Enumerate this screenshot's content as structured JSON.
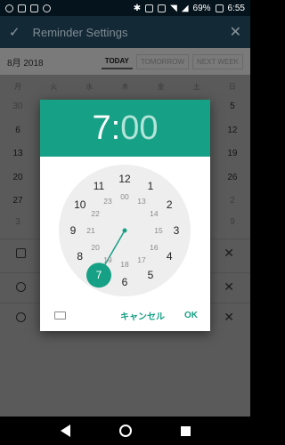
{
  "status_bar": {
    "battery": "69%",
    "time": "6:55",
    "left_icons": [
      "alarm-icon",
      "image-icon",
      "image-icon",
      "emoji-icon"
    ],
    "right_icons": [
      "bluetooth-icon",
      "nfc-icon",
      "vibrate-icon",
      "wifi-icon",
      "signal-icon",
      "battery-icon"
    ]
  },
  "app_bar": {
    "title": "Reminder Settings"
  },
  "calendar": {
    "month": "8月 2018",
    "buttons": [
      "TODAY",
      "TOMORROW",
      "NEXT WEEK"
    ],
    "weekdays": [
      "月",
      "火",
      "水",
      "木",
      "金",
      "土",
      "日"
    ],
    "rows": [
      [
        "30",
        "",
        "",
        "",
        "",
        "",
        "5"
      ],
      [
        "6",
        "",
        "",
        "",
        "",
        "",
        "12"
      ],
      [
        "13",
        "",
        "",
        "",
        "",
        "",
        "19"
      ],
      [
        "20",
        "",
        "",
        "",
        "",
        "",
        "26"
      ],
      [
        "27",
        "",
        "",
        "",
        "",
        "",
        "2"
      ],
      [
        "3",
        "",
        "",
        "",
        "",
        "",
        "9"
      ]
    ]
  },
  "dialog": {
    "hour": "7",
    "colon": ":",
    "minute": "00",
    "outer_hours": [
      "12",
      "1",
      "2",
      "3",
      "4",
      "5",
      "6",
      "7",
      "8",
      "9",
      "10",
      "11"
    ],
    "inner_hours": [
      "00",
      "13",
      "14",
      "15",
      "16",
      "17",
      "18",
      "19",
      "20",
      "21",
      "22",
      "23"
    ],
    "selected_hour": "7",
    "cancel_label": "キャンセル",
    "ok_label": "OK"
  },
  "colors": {
    "accent": "#16a085",
    "dial_bg": "#eeeeee"
  }
}
